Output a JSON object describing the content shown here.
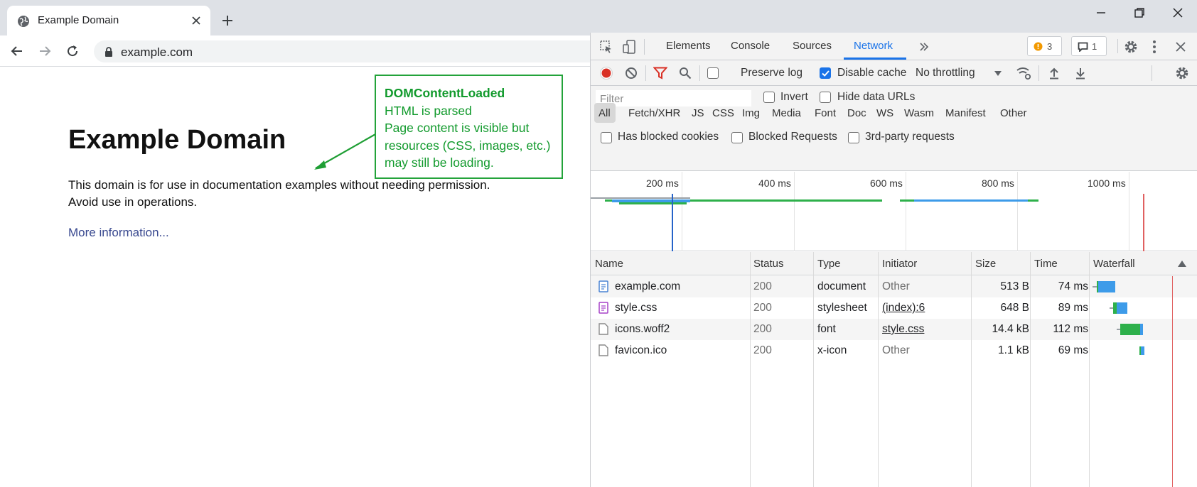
{
  "browser": {
    "tab_title": "Example Domain",
    "url": "example.com"
  },
  "page": {
    "heading": "Example Domain",
    "paragraph_line1": "This domain is for use in documentation examples without needing permission.",
    "paragraph_line2": "Avoid use in operations.",
    "link_text": "More information..."
  },
  "annotation": {
    "title": "DOMContentLoaded",
    "lines": [
      "HTML is parsed",
      "Page content is visible but",
      "resources (CSS, images, etc.)",
      "may still be loading."
    ],
    "color": "#119a2c"
  },
  "devtools": {
    "tabs": [
      "Elements",
      "Console",
      "Sources",
      "Network"
    ],
    "active_tab": "Network",
    "issues_count": "3",
    "messages_count": "1",
    "toolbar": {
      "preserve_log": "Preserve log",
      "preserve_log_checked": false,
      "disable_cache": "Disable cache",
      "disable_cache_checked": true,
      "throttling": "No throttling"
    },
    "filter": {
      "placeholder": "Filter",
      "invert": "Invert",
      "hide_data_urls": "Hide data URLs",
      "types": [
        "All",
        "Fetch/XHR",
        "JS",
        "CSS",
        "Img",
        "Media",
        "Font",
        "Doc",
        "WS",
        "Wasm",
        "Manifest",
        "Other"
      ],
      "active_type": "All",
      "has_blocked_cookies": "Has blocked cookies",
      "blocked_requests": "Blocked Requests",
      "third_party": "3rd-party requests"
    },
    "overview_ticks": [
      "200 ms",
      "400 ms",
      "600 ms",
      "800 ms",
      "1000 ms"
    ],
    "columns": [
      "Name",
      "Status",
      "Type",
      "Initiator",
      "Size",
      "Time",
      "Waterfall"
    ],
    "requests": [
      {
        "name": "example.com",
        "status": "200",
        "type": "document",
        "initiator": "Other",
        "initiator_link": false,
        "size": "513 B",
        "time": "74 ms",
        "icon": "document-icon"
      },
      {
        "name": "style.css",
        "status": "200",
        "type": "stylesheet",
        "initiator": "(index):6",
        "initiator_link": true,
        "size": "648 B",
        "time": "89 ms",
        "icon": "stylesheet-icon"
      },
      {
        "name": "icons.woff2",
        "status": "200",
        "type": "font",
        "initiator": "style.css",
        "initiator_link": true,
        "size": "14.4 kB",
        "time": "112 ms",
        "icon": "file-icon"
      },
      {
        "name": "favicon.ico",
        "status": "200",
        "type": "x-icon",
        "initiator": "Other",
        "initiator_link": false,
        "size": "1.1 kB",
        "time": "69 ms",
        "icon": "file-icon"
      }
    ],
    "colors": {
      "accent": "#1a73e8",
      "record": "#d93025",
      "waiting": "#2eb04b",
      "download": "#3d9be9",
      "load_line": "#e06060",
      "dcl_line": "#2563c9"
    }
  }
}
